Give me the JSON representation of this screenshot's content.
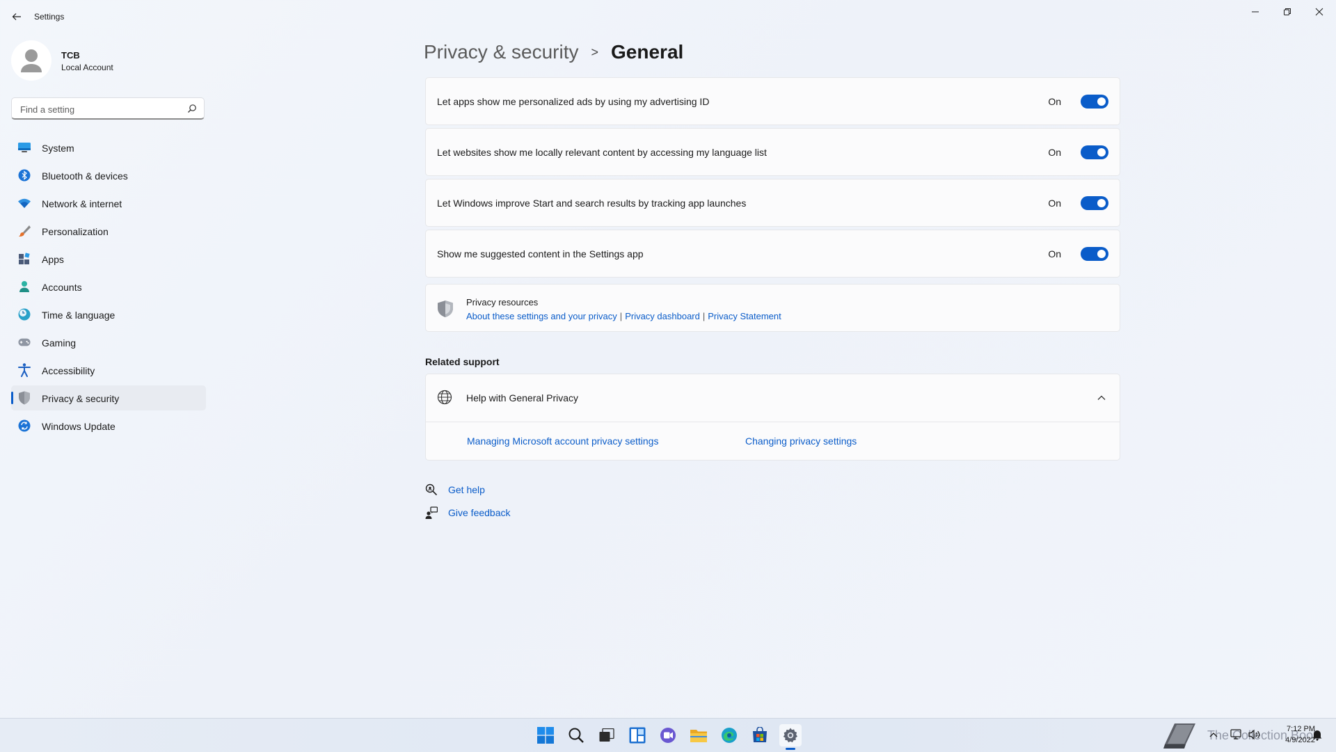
{
  "window": {
    "title": "Settings"
  },
  "profile": {
    "name": "TCB",
    "account_type": "Local Account"
  },
  "search": {
    "placeholder": "Find a setting",
    "value": ""
  },
  "nav": {
    "items": [
      {
        "label": "System",
        "icon": "monitor-icon"
      },
      {
        "label": "Bluetooth & devices",
        "icon": "bluetooth-icon"
      },
      {
        "label": "Network & internet",
        "icon": "wifi-icon"
      },
      {
        "label": "Personalization",
        "icon": "brush-icon"
      },
      {
        "label": "Apps",
        "icon": "apps-icon"
      },
      {
        "label": "Accounts",
        "icon": "person-icon"
      },
      {
        "label": "Time & language",
        "icon": "clock-globe-icon"
      },
      {
        "label": "Gaming",
        "icon": "gamepad-icon"
      },
      {
        "label": "Accessibility",
        "icon": "accessibility-icon"
      },
      {
        "label": "Privacy & security",
        "icon": "shield-icon",
        "selected": true
      },
      {
        "label": "Windows Update",
        "icon": "update-icon"
      }
    ]
  },
  "breadcrumb": {
    "parent": "Privacy & security",
    "separator": ">",
    "current": "General"
  },
  "settings": [
    {
      "label": "Let apps show me personalized ads by using my advertising ID",
      "state": "On"
    },
    {
      "label": "Let websites show me locally relevant content by accessing my language list",
      "state": "On"
    },
    {
      "label": "Let Windows improve Start and search results by tracking app launches",
      "state": "On"
    },
    {
      "label": "Show me suggested content in the Settings app",
      "state": "On"
    }
  ],
  "privacy_resources": {
    "title": "Privacy resources",
    "links": [
      "About these settings and your privacy",
      "Privacy dashboard",
      "Privacy Statement"
    ],
    "separator": "|"
  },
  "related_support": {
    "title": "Related support",
    "help_title": "Help with General Privacy",
    "links": [
      "Managing Microsoft account privacy settings",
      "Changing privacy settings"
    ]
  },
  "footer_links": {
    "get_help": "Get help",
    "give_feedback": "Give feedback"
  },
  "taskbar": {
    "watermark": "The Collection Book",
    "time": "7:12 PM",
    "date": "4/9/2022"
  },
  "colors": {
    "accent": "#0a5cc9",
    "background": "#f3f6fb",
    "card": "#fbfbfc"
  }
}
